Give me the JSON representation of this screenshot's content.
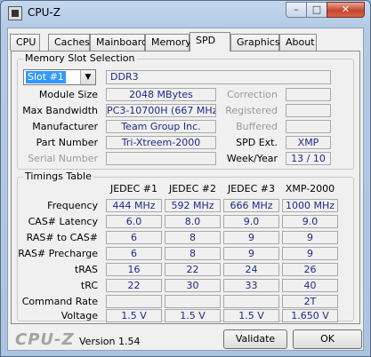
{
  "window": {
    "title": "CPU-Z",
    "min": "–",
    "max": "□",
    "close": "✕"
  },
  "tabs": [
    "CPU",
    "Caches",
    "Mainboard",
    "Memory",
    "SPD",
    "Graphics",
    "About"
  ],
  "active_tab": "SPD",
  "memory_slot": {
    "title": "Memory Slot Selection",
    "slot_value": "Slot #1",
    "type": "DDR3",
    "module_size_label": "Module Size",
    "module_size": "2048 MBytes",
    "max_bandwidth_label": "Max Bandwidth",
    "max_bandwidth": "PC3-10700H (667 MHz)",
    "manufacturer_label": "Manufacturer",
    "manufacturer": "Team Group Inc.",
    "part_number_label": "Part Number",
    "part_number": "Tri-Xtreem-2000",
    "serial_number_label": "Serial Number",
    "serial_number": "",
    "correction_label": "Correction",
    "correction": "",
    "registered_label": "Registered",
    "registered": "",
    "buffered_label": "Buffered",
    "buffered": "",
    "spd_ext_label": "SPD Ext.",
    "spd_ext": "XMP",
    "week_year_label": "Week/Year",
    "week_year": "13 / 10"
  },
  "timings": {
    "title": "Timings Table",
    "columns": [
      "JEDEC #1",
      "JEDEC #2",
      "JEDEC #3",
      "XMP-2000"
    ],
    "rows": [
      {
        "label": "Frequency",
        "values": [
          "444 MHz",
          "592 MHz",
          "666 MHz",
          "1000 MHz"
        ]
      },
      {
        "label": "CAS# Latency",
        "values": [
          "6.0",
          "8.0",
          "9.0",
          "9.0"
        ]
      },
      {
        "label": "RAS# to CAS#",
        "values": [
          "6",
          "8",
          "9",
          "9"
        ]
      },
      {
        "label": "RAS# Precharge",
        "values": [
          "6",
          "8",
          "9",
          "9"
        ]
      },
      {
        "label": "tRAS",
        "values": [
          "16",
          "22",
          "24",
          "26"
        ]
      },
      {
        "label": "tRC",
        "values": [
          "22",
          "30",
          "33",
          "40"
        ]
      },
      {
        "label": "Command Rate",
        "values": [
          "",
          "",
          "",
          "2T"
        ]
      },
      {
        "label": "Voltage",
        "values": [
          "1.5 V",
          "1.5 V",
          "1.5 V",
          "1.650 V"
        ]
      }
    ]
  },
  "footer": {
    "logo": "CPU-Z",
    "version": "Version 1.54",
    "validate": "Validate",
    "ok": "OK"
  }
}
